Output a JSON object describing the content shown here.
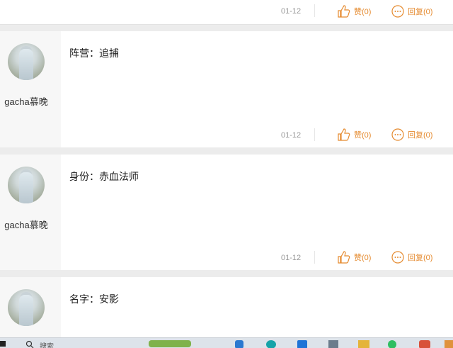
{
  "posts": [
    {
      "date": "01-12",
      "like_label": "赞(0)",
      "reply_label": "回复(0)"
    },
    {
      "username": "gacha慕晚",
      "content": "阵营：追捕",
      "date": "01-12",
      "like_label": "赞(0)",
      "reply_label": "回复(0)"
    },
    {
      "username": "gacha慕晚",
      "content": "身份：赤血法师",
      "date": "01-12",
      "like_label": "赞(0)",
      "reply_label": "回复(0)"
    },
    {
      "content": "名字：安影"
    }
  ],
  "icons": {
    "like": "thumbs-up-icon",
    "reply": "speech-bubble-icon"
  },
  "colors": {
    "accent": "#e58a2e",
    "meta": "#999999",
    "background": "#ececec"
  },
  "taskbar": {
    "search_placeholder": "搜索"
  }
}
